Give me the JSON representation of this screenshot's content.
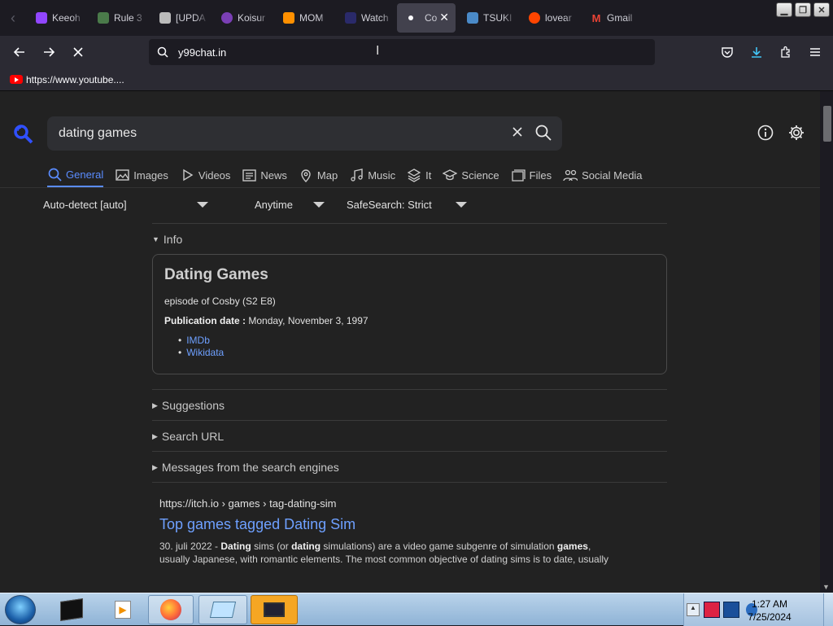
{
  "browser": {
    "tabs": [
      {
        "title": "Keeoh",
        "icon": "twitch-icon",
        "color": "#9146ff"
      },
      {
        "title": "Rule 3",
        "icon": "rule34-icon",
        "color": "#4a7a4a"
      },
      {
        "title": "[UPDA",
        "icon": "page-icon",
        "color": "#bbbbbb"
      },
      {
        "title": "Koisur",
        "icon": "koisuru-icon",
        "color": "#7a3fb5"
      },
      {
        "title": "MOM",
        "icon": "ph-icon",
        "color": "#ff9000"
      },
      {
        "title": "Watch",
        "icon": "watch-icon",
        "color": "#2a2a6a"
      },
      {
        "title": "Co",
        "icon": "loading-dot-icon",
        "color": "#fbfbfe",
        "active": true
      },
      {
        "title": "TSUKI",
        "icon": "tsuki-icon",
        "color": "#4a8ac8"
      },
      {
        "title": "lovear",
        "icon": "reddit-icon",
        "color": "#ff4500"
      },
      {
        "title": "Gmail",
        "icon": "gmail-icon",
        "color": "#ea4335"
      }
    ],
    "url": "y99chat.in",
    "bookmarks": [
      {
        "label": "https://www.youtube....",
        "icon": "youtube-icon"
      }
    ]
  },
  "search": {
    "query": "dating games",
    "categories": [
      {
        "label": "General",
        "icon": "search-icon",
        "active": true
      },
      {
        "label": "Images",
        "icon": "image-icon"
      },
      {
        "label": "Videos",
        "icon": "play-icon"
      },
      {
        "label": "News",
        "icon": "newspaper-icon"
      },
      {
        "label": "Map",
        "icon": "map-pin-icon"
      },
      {
        "label": "Music",
        "icon": "music-icon"
      },
      {
        "label": "It",
        "icon": "layers-icon"
      },
      {
        "label": "Science",
        "icon": "graduation-cap-icon"
      },
      {
        "label": "Files",
        "icon": "files-icon"
      },
      {
        "label": "Social Media",
        "icon": "people-icon"
      }
    ],
    "filters": {
      "language": "Auto-detect [auto]",
      "time": "Anytime",
      "safesearch": "SafeSearch: Strict"
    }
  },
  "info": {
    "section_label": "Info",
    "title": "Dating Games",
    "subtitle": "episode of Cosby (S2 E8)",
    "pub_label": "Publication date :",
    "pub_value": "Monday, November 3, 1997",
    "links": [
      "IMDb",
      "Wikidata"
    ]
  },
  "sections": [
    "Suggestions",
    "Search URL",
    "Messages from the search engines"
  ],
  "result": {
    "url": "https://itch.io  › games › tag-dating-sim",
    "title": "Top games tagged Dating Sim",
    "date": "30. juli 2022 - ",
    "snippet_html_parts": [
      "Dating",
      " sims (or ",
      "dating",
      " simulations) are a video game subgenre of simulation ",
      "games",
      ","
    ],
    "snippet_line2": "usually Japanese, with romantic elements. The most common objective of dating sims is to date, usually"
  },
  "taskbar": {
    "time": "1:27 AM",
    "date": "7/25/2024"
  }
}
